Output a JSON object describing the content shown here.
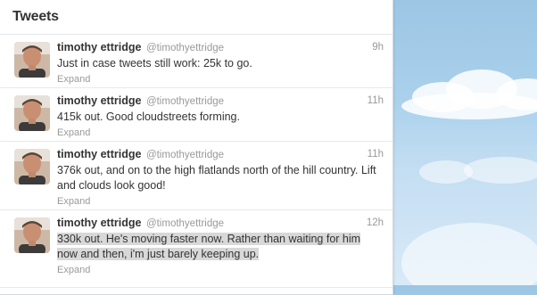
{
  "timeline": {
    "title": "Tweets"
  },
  "tweets": [
    {
      "fullname": "timothy ettridge",
      "handle": "@timothyettridge",
      "time": "9h",
      "text": "Just in case tweets still work: 25k to go.",
      "expand": "Expand"
    },
    {
      "fullname": "timothy ettridge",
      "handle": "@timothyettridge",
      "time": "11h",
      "text": "415k out. Good cloudstreets forming.",
      "expand": "Expand"
    },
    {
      "fullname": "timothy ettridge",
      "handle": "@timothyettridge",
      "time": "11h",
      "text": "376k out, and on to the high flatlands north of the hill country. Lift and clouds look good!",
      "expand": "Expand"
    },
    {
      "fullname": "timothy ettridge",
      "handle": "@timothyettridge",
      "time": "12h",
      "text": "330k out. He's moving faster now. Rather than waiting for him now and then, i'm just barely keeping up.",
      "expand": "Expand"
    }
  ],
  "colors": {
    "text": "#333333",
    "muted": "#999999",
    "selection": "#d8d8d8",
    "sky": "#9cc6e4"
  }
}
